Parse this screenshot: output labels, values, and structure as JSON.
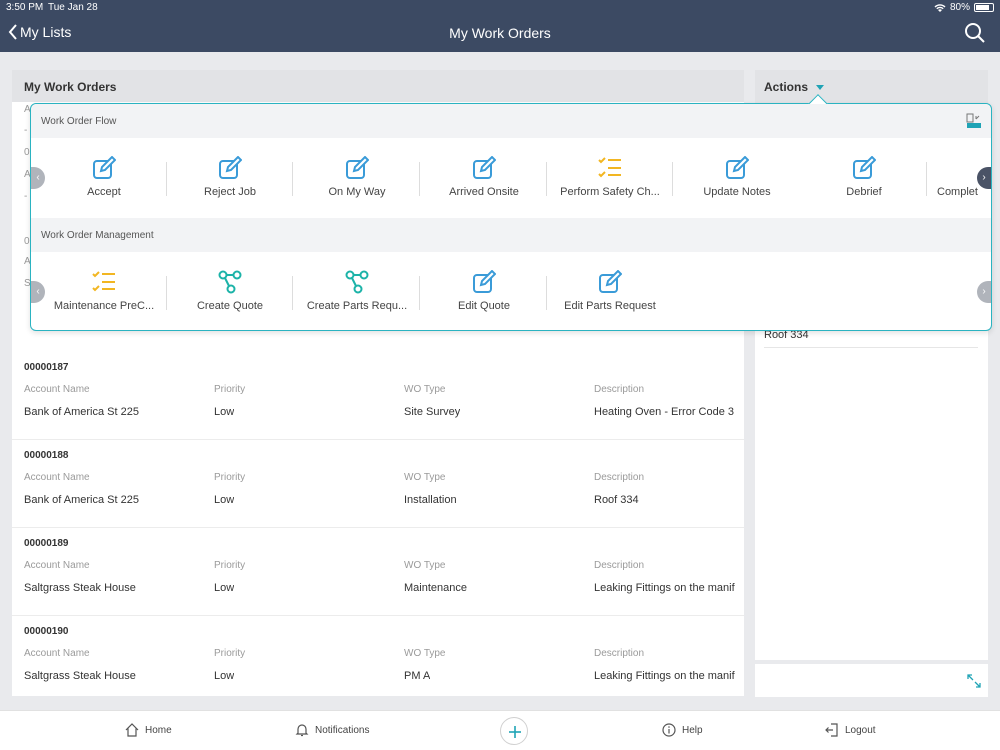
{
  "status": {
    "time": "3:50 PM",
    "date": "Tue Jan 28",
    "battery": "80%"
  },
  "nav": {
    "back_label": "My Lists",
    "title": "My Work Orders"
  },
  "main": {
    "header": "My Work Orders",
    "columns": {
      "account": "Account Name",
      "priority": "Priority",
      "type": "WO Type",
      "description": "Description"
    },
    "rows": [
      {
        "number": "00000187",
        "account": "Bank of America St 225",
        "priority": "Low",
        "type": "Site Survey",
        "description": "Heating Oven - Error Code 3"
      },
      {
        "number": "00000188",
        "account": "Bank of America St 225",
        "priority": "Low",
        "type": "Installation",
        "description": "Roof 334"
      },
      {
        "number": "00000189",
        "account": "Saltgrass Steak House",
        "priority": "Low",
        "type": "Maintenance",
        "description": "Leaking Fittings on the manif"
      },
      {
        "number": "00000190",
        "account": "Saltgrass Steak House",
        "priority": "Low",
        "type": "PM A",
        "description": "Leaking Fittings on the manif"
      }
    ],
    "partials": [
      "A",
      "-",
      "0",
      "A",
      "-",
      "0",
      "A",
      "S"
    ]
  },
  "side": {
    "header": "Actions",
    "roof_text": "Roof 334"
  },
  "popover": {
    "section1": {
      "title": "Work Order Flow",
      "items": [
        {
          "label": "Accept",
          "icon": "edit-icon"
        },
        {
          "label": "Reject Job",
          "icon": "edit-icon"
        },
        {
          "label": "On My Way",
          "icon": "edit-icon"
        },
        {
          "label": "Arrived Onsite",
          "icon": "edit-icon"
        },
        {
          "label": "Perform Safety Ch...",
          "icon": "checklist-icon"
        },
        {
          "label": "Update Notes",
          "icon": "edit-icon"
        },
        {
          "label": "Debrief",
          "icon": "edit-icon"
        },
        {
          "label": "Complet",
          "icon": "edit-icon"
        }
      ]
    },
    "section2": {
      "title": "Work Order Management",
      "items": [
        {
          "label": "Maintenance PreC...",
          "icon": "checklist-icon"
        },
        {
          "label": "Create Quote",
          "icon": "share-icon"
        },
        {
          "label": "Create Parts Requ...",
          "icon": "share-icon"
        },
        {
          "label": "Edit Quote",
          "icon": "edit-icon"
        },
        {
          "label": "Edit Parts Request",
          "icon": "edit-icon"
        }
      ]
    }
  },
  "tabbar": {
    "home": "Home",
    "notifications": "Notifications",
    "help": "Help",
    "logout": "Logout"
  },
  "colors": {
    "navbar": "#3c4a63",
    "accent": "#1fa3b5",
    "edit_icon": "#3a9bd8",
    "checklist_icon": "#f2b622",
    "share_icon": "#1cb3a8"
  }
}
